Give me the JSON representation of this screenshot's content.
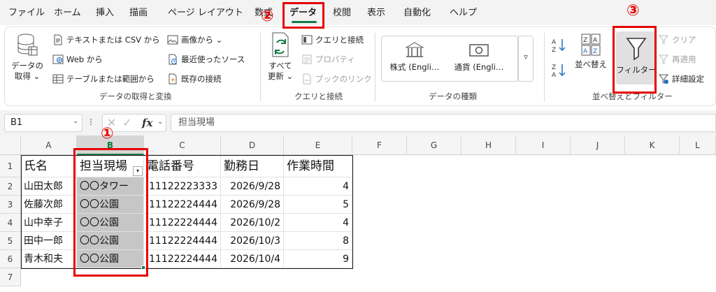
{
  "tabs": [
    "ファイル",
    "ホーム",
    "挿入",
    "描画",
    "ページ レイアウト",
    "数式",
    "データ",
    "校閲",
    "表示",
    "自動化",
    "ヘルプ"
  ],
  "active_tab": "データ",
  "ribbon": {
    "get_data": {
      "l1": "データの",
      "l2": "取得 ⌄"
    },
    "text_csv": "テキストまたは CSV から",
    "web": "Web から",
    "table_range": "テーブルまたは範囲から",
    "image": "画像から ⌄",
    "recent": "最近使ったソース",
    "existing": "既存の接続",
    "group1": "データの取得と変換",
    "refresh": {
      "l1": "すべて",
      "l2": "更新 ⌄"
    },
    "queries": "クエリと接続",
    "properties": "プロパティ",
    "edit_links": "ブックのリンク",
    "group2": "クエリと接続",
    "stocks": "株式 (Engli…",
    "currency": "通貨 (Engli…",
    "group3": "データの種類",
    "sort": "並べ替え",
    "filter": "フィルター",
    "clear": "クリア",
    "reapply": "再適用",
    "advanced": "詳細設定",
    "group4": "並べ替えとフィルター"
  },
  "formula_bar": {
    "namebox": "B1",
    "fx": "fx",
    "content": "担当現場"
  },
  "columns": [
    "A",
    "B",
    "C",
    "D",
    "E",
    "F",
    "G",
    "H",
    "I",
    "J",
    "K",
    "L"
  ],
  "rows": [
    "1",
    "2",
    "3",
    "4",
    "5",
    "6",
    "7"
  ],
  "table": {
    "headers": [
      "氏名",
      "担当現場",
      "電話番号",
      "勤務日",
      "作業時間"
    ],
    "data": [
      [
        "山田太郎",
        "〇〇タワー",
        "11122223333",
        "2026/9/28",
        "4"
      ],
      [
        "佐藤次郎",
        "〇〇公園",
        "11122224444",
        "2026/9/28",
        "5"
      ],
      [
        "山中幸子",
        "〇〇公園",
        "11122224444",
        "2026/10/2",
        "4"
      ],
      [
        "田中一郎",
        "〇〇公園",
        "11122224444",
        "2026/10/3",
        "8"
      ],
      [
        "青木和夫",
        "〇〇公園",
        "11122224444",
        "2026/10/4",
        "9"
      ]
    ]
  },
  "annotations": {
    "m1": "①",
    "m2": "②",
    "m3": "③"
  },
  "colors": {
    "accent": "#107c41",
    "annotation": "#e60000"
  }
}
